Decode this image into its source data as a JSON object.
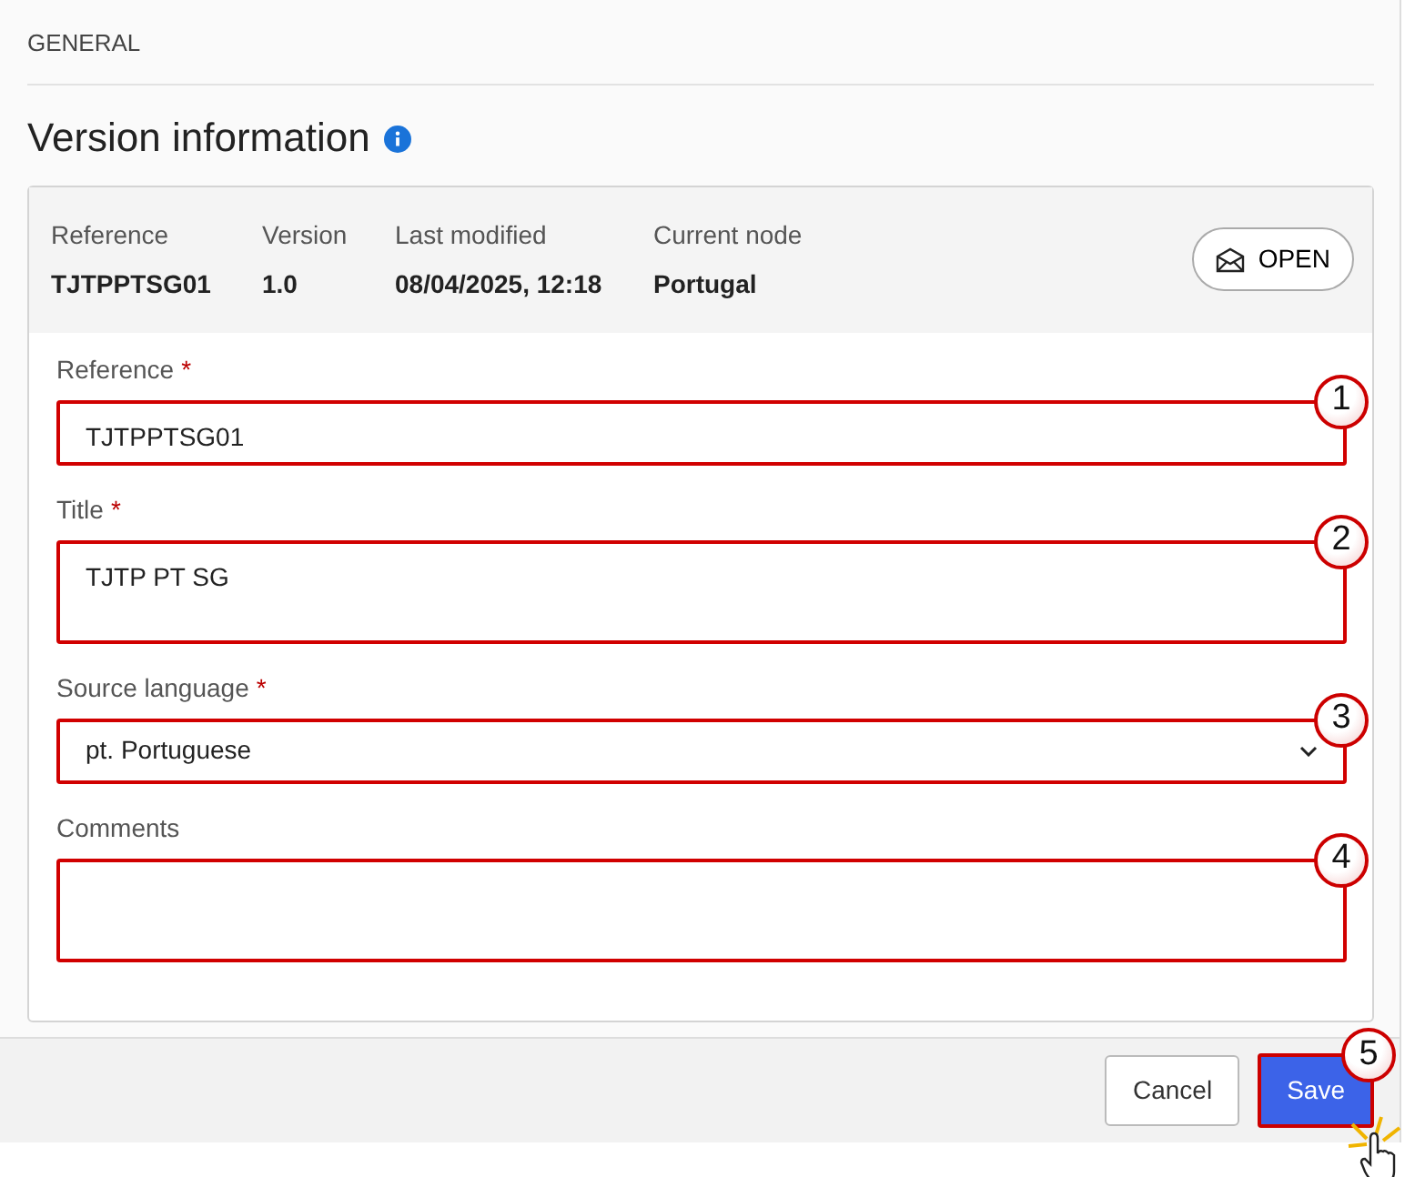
{
  "section_label": "GENERAL",
  "heading": {
    "title": "Version information"
  },
  "summary": [
    {
      "label": "Reference",
      "value": "TJTPPTSG01"
    },
    {
      "label": "Version",
      "value": "1.0"
    },
    {
      "label": "Last modified",
      "value": "08/04/2025, 12:18"
    },
    {
      "label": "Current node",
      "value": "Portugal"
    }
  ],
  "status_button": "OPEN",
  "fields": [
    {
      "kind": "input",
      "label": "Reference",
      "required_mark": "*",
      "value": "TJTPPTSG01",
      "highlighted": true,
      "callout": "1"
    },
    {
      "kind": "textarea",
      "label": "Title",
      "required_mark": "*",
      "value": "TJTP PT SG",
      "highlighted": true,
      "callout": "2"
    },
    {
      "kind": "select",
      "label": "Source language",
      "required_mark": "*",
      "value": "pt. Portuguese",
      "highlighted": true,
      "callout": "3"
    },
    {
      "kind": "textarea",
      "label": "Comments",
      "highlighted": true,
      "callout": "4"
    }
  ],
  "buttons": [
    {
      "label": "Cancel",
      "kind": "secondary"
    },
    {
      "label": "Save",
      "kind": "primary",
      "highlighted": true,
      "callout": "5",
      "cursor": true
    }
  ]
}
